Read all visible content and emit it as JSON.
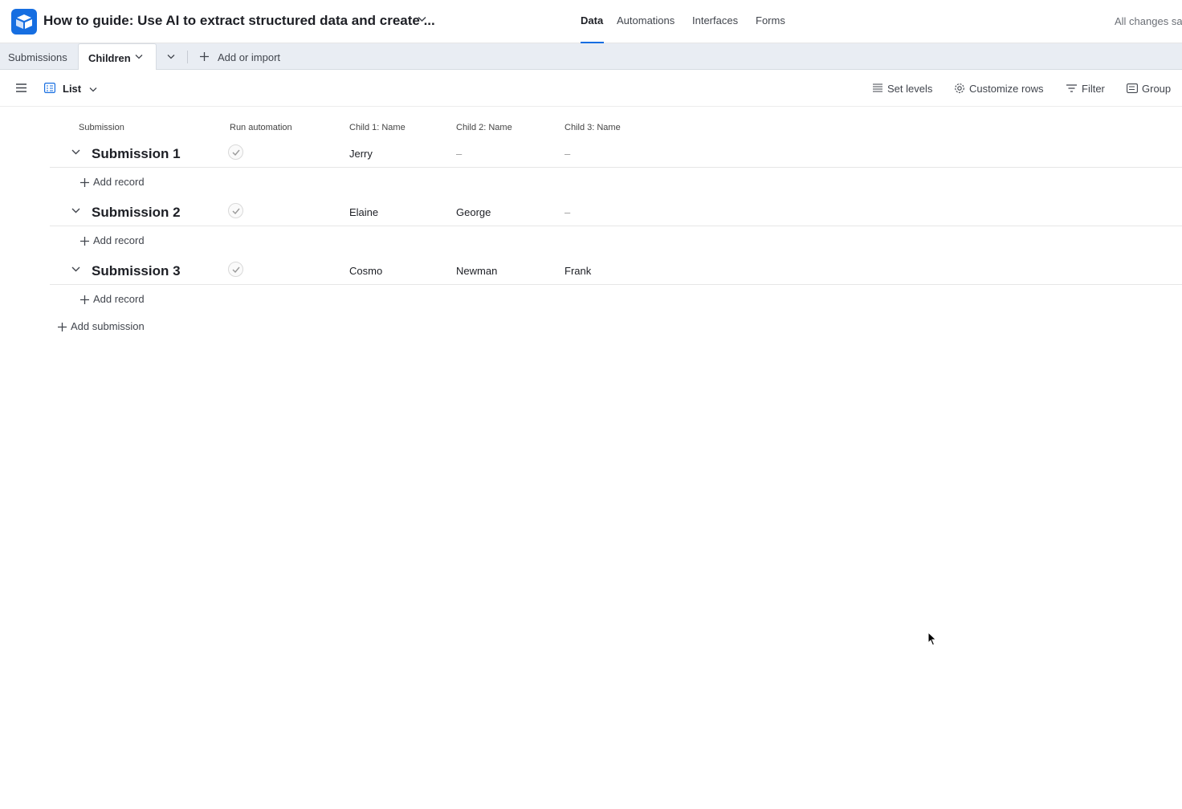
{
  "header": {
    "base_title": "How to guide: Use AI to extract structured data and create ...",
    "nav": [
      "Data",
      "Automations",
      "Interfaces",
      "Forms"
    ],
    "active_nav": "Data",
    "save_status": "All changes sa"
  },
  "tabs": {
    "items": [
      "Submissions",
      "Children"
    ],
    "active": "Children",
    "add_label": "Add or import"
  },
  "viewbar": {
    "view_name": "List",
    "set_levels": "Set levels",
    "customize_rows": "Customize rows",
    "filter": "Filter",
    "group": "Group"
  },
  "table": {
    "columns": [
      "Submission",
      "Run automation",
      "Child 1: Name",
      "Child 2: Name",
      "Child 3: Name"
    ],
    "rows": [
      {
        "title": "Submission 1",
        "automated": true,
        "child1": "Jerry",
        "child2": "–",
        "child3": "–"
      },
      {
        "title": "Submission 2",
        "automated": true,
        "child1": "Elaine",
        "child2": "George",
        "child3": "–"
      },
      {
        "title": "Submission 3",
        "automated": true,
        "child1": "Cosmo",
        "child2": "Newman",
        "child3": "Frank"
      }
    ],
    "add_record_label": "Add record",
    "add_submission_label": "Add submission"
  },
  "colors": {
    "brand": "#166ee1",
    "tab_bar": "#e9edf3"
  }
}
